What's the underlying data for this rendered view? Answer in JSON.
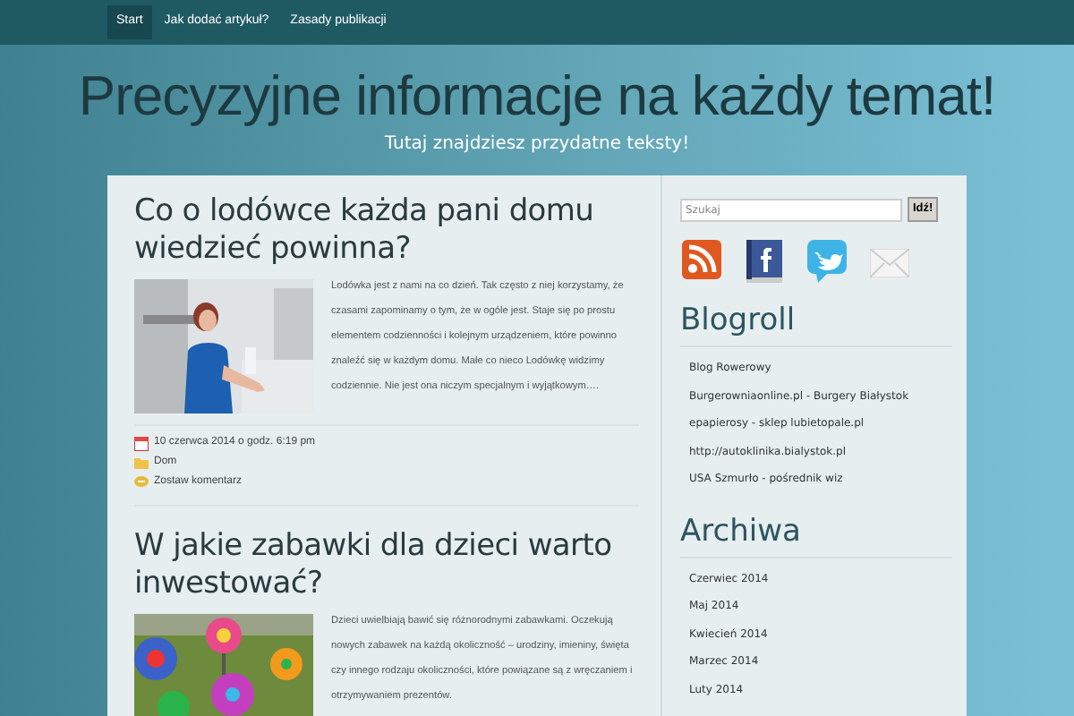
{
  "nav": [
    {
      "label": "Start",
      "selected": true
    },
    {
      "label": "Jak dodać artykuł?",
      "selected": false
    },
    {
      "label": "Zasady publikacji",
      "selected": false
    }
  ],
  "site": {
    "title": "Precyzyjne informacje na każdy temat!",
    "tagline": "Tutaj znajdziesz przydatne teksty!"
  },
  "posts": [
    {
      "title": "Co o lodówce każda pani domu wiedzieć powinna?",
      "excerpt": "Lodówka jest z nami na co dzień. Tak często z niej korzystamy, że czasami zapominamy o tym, że w ogóle jest. Staje się po prostu elementem codzienności i kolejnym urządzeniem, które powinno znaleźć się w każdym domu. Małe co nieco Lodówkę widzimy codziennie. Nie jest ona niczym specjalnym i wyjątkowym….",
      "date": "10 czerwca 2014 o godz. 6:19 pm",
      "category": "Dom",
      "comments": "Zostaw komentarz"
    },
    {
      "title": "W jakie zabawki dla dzieci warto inwestować?",
      "excerpt": "Dzieci uwielbiają bawić się różnorodnymi zabawkami. Oczekują nowych zabawek na każdą okoliczność – urodziny, imieniny, święta czy innego rodzaju okoliczności, które powiązane są z wręczaniem i otrzymywaniem prezentów."
    }
  ],
  "search": {
    "placeholder": "Szukaj",
    "button": "Idź!"
  },
  "blogroll": {
    "title": "Blogroll",
    "links": [
      "Blog Rowerowy",
      "Burgerowniaonline.pl - Burgery Białystok",
      "epapierosy - sklep lubietopale.pl",
      "http://autoklinika.bialystok.pl",
      "USA Szmurło - pośrednik wiz"
    ]
  },
  "archives": {
    "title": "Archiwa",
    "links": [
      "Czerwiec 2014",
      "Maj 2014",
      "Kwiecień 2014",
      "Marzec 2014",
      "Luty 2014"
    ]
  }
}
